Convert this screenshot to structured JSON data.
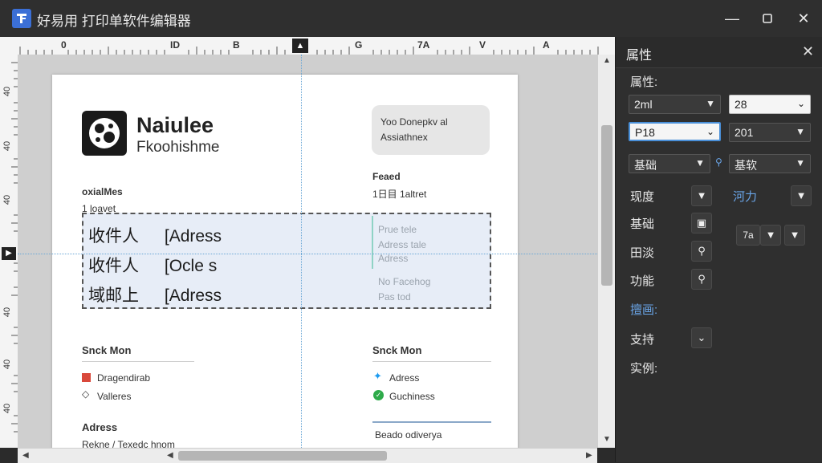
{
  "window": {
    "title": "好易用 打印单软件编辑器",
    "minimize_icon": "minimize-icon",
    "maximize_icon": "maximize-icon",
    "close_icon": "close-icon"
  },
  "ruler": {
    "top_labels": [
      "0",
      "ID",
      "B",
      "",
      "G",
      "7A",
      "V",
      "A"
    ],
    "left_labels": [
      "40",
      "40",
      "40",
      "40",
      "40",
      "40",
      "40"
    ]
  },
  "document": {
    "company_name": "Naiulee",
    "company_sub": "Fkoohishme",
    "note_lines": [
      "Yoo Donepkv al",
      "Assiathnex"
    ],
    "left_label": "oxialMes",
    "left_sub": "1 loavet",
    "right_label": "Feaed",
    "right_sub": "1日目 1altret",
    "selection_rows": [
      {
        "label": "收件人",
        "value": "Adress"
      },
      {
        "label": "收件人",
        "value": "Ocle s"
      },
      {
        "label": "域邮上",
        "value": "Adress"
      }
    ],
    "faint_right": [
      "Prue tele",
      "Adress tale",
      "Adress",
      "No Facehog",
      "Pas tod"
    ],
    "section_left_title": "Snck Mon",
    "section_left_items": [
      "Dragendirab",
      "Valleres"
    ],
    "section_right_title": "Snck Mon",
    "section_right_items": [
      "Adress",
      "Guchiness"
    ],
    "footer_left_title": "Adress",
    "footer_left_sub": "Rekne / Texedc hnom",
    "footer_right": "Beado odiverya"
  },
  "panel": {
    "title": "属性",
    "close_icon": "close-icon",
    "section_label": "属性:",
    "dd_row1": [
      "2ml",
      "28"
    ],
    "dd_row2": [
      "P18",
      "201"
    ],
    "dd_row3": [
      "基础",
      "基软"
    ],
    "rows": [
      {
        "label": "现度",
        "right_label": "河力"
      },
      {
        "label": "基础"
      },
      {
        "label": "田淡"
      },
      {
        "label": "功能"
      }
    ],
    "blue_label": "擅画:",
    "row_after_blue": "支持",
    "last_label": "实例:",
    "mini_value": "7a"
  }
}
